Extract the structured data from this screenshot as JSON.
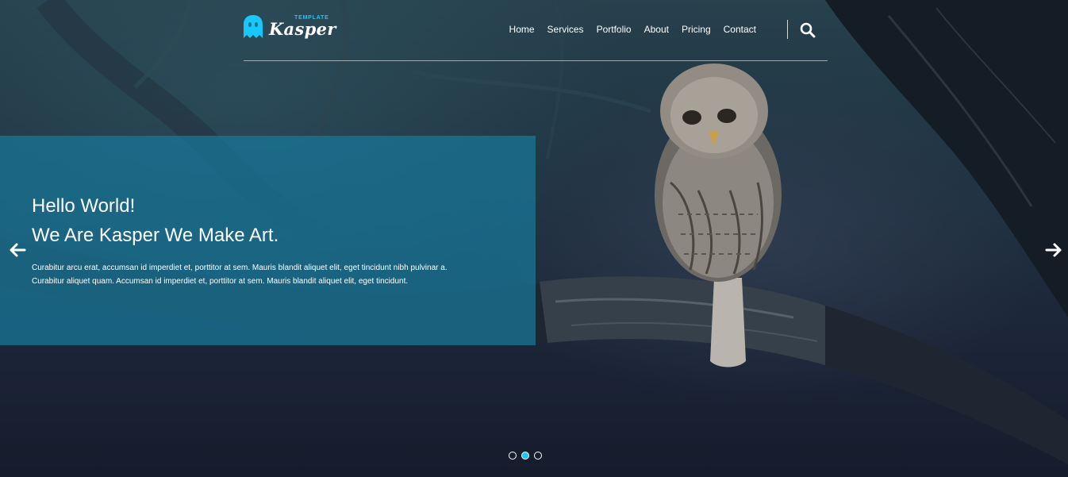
{
  "brand": {
    "name": "Kasper",
    "tag": "TEMPLATE",
    "accent": "#19c8fa",
    "icon": "ghost-icon"
  },
  "nav": {
    "items": [
      "Home",
      "Services",
      "Portfolio",
      "About",
      "Pricing",
      "Contact"
    ]
  },
  "search": {
    "icon": "search-icon"
  },
  "slide": {
    "heading_line1": "Hello World!",
    "heading_line2": "We Are Kasper We Make Art.",
    "body_line1": "Curabitur arcu erat, accumsan id imperdiet et, porttitor at sem. Mauris blandit aliquet elit, eget tincidunt nibh pulvinar a.",
    "body_line2": "Curabitur aliquet quam. Accumsan id imperdiet et, porttitor at sem. Mauris blandit aliquet elit, eget tincidunt.",
    "panel_color": "#17789b"
  },
  "slider": {
    "prev_icon": "arrow-left-icon",
    "next_icon": "arrow-right-icon",
    "dot_count": 3,
    "active_dot": 2
  }
}
